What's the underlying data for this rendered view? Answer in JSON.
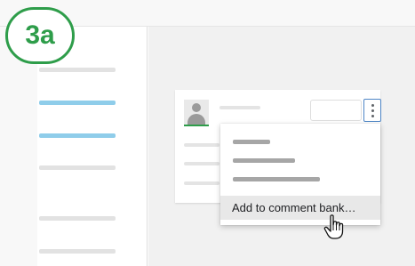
{
  "step": {
    "label": "3a",
    "color": "#2e9d4a"
  },
  "menu": {
    "items": [
      {
        "label": "Add to comment bank…",
        "highlighted": true
      }
    ]
  },
  "icons": {
    "avatar": "person-avatar-icon",
    "more": "more-vert-icon",
    "cursor": "hand-pointer-icon"
  },
  "colors": {
    "sidebar_active": "#8fcdea",
    "focus_outline": "#4f86c6",
    "menu_highlight": "#e8e8e8"
  }
}
